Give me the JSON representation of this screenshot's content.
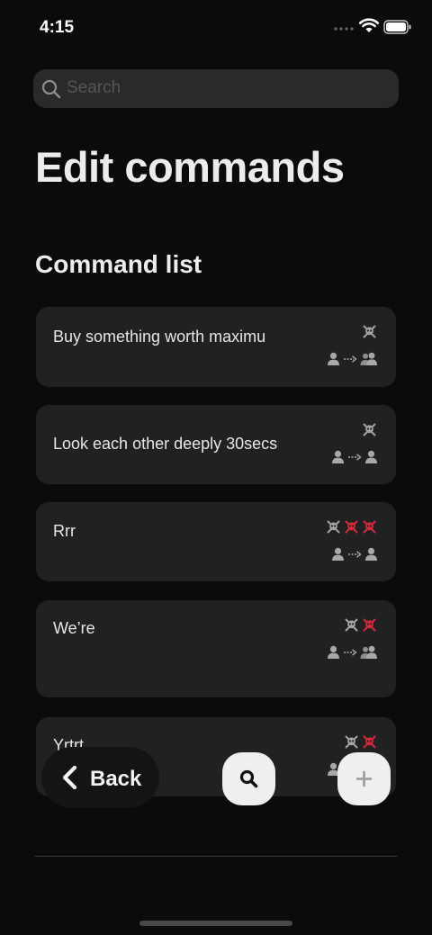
{
  "status_bar": {
    "time": "4:15"
  },
  "search": {
    "placeholder": "Search"
  },
  "page": {
    "title": "Edit commands",
    "section_title": "Command list"
  },
  "colors": {
    "skull_grey": "#a3a3a3",
    "skull_red": "#d42b3c",
    "card_bg": "#222121",
    "background": "#0c0b0b"
  },
  "commands": [
    {
      "label": "Buy something worth maximu",
      "skulls": [
        "grey"
      ],
      "target": "person-to-group"
    },
    {
      "label": "Look each other deeply 30secs",
      "skulls": [
        "grey"
      ],
      "target": "person-to-person"
    },
    {
      "label": "Rrr",
      "skulls": [
        "grey",
        "red",
        "red"
      ],
      "target": "person-to-person"
    },
    {
      "label": "We’re",
      "skulls": [
        "grey",
        "red"
      ],
      "target": "person-to-group"
    },
    {
      "label": "Yrtrt",
      "skulls": [
        "grey",
        "red"
      ],
      "target": "person-to-group"
    }
  ],
  "bottom_bar": {
    "back_label": "Back"
  },
  "icons": [
    "search-icon",
    "skull-icon",
    "person-icon",
    "group-icon",
    "arrow-icon",
    "chevron-left-icon",
    "plus-icon",
    "wifi-icon",
    "battery-icon"
  ]
}
